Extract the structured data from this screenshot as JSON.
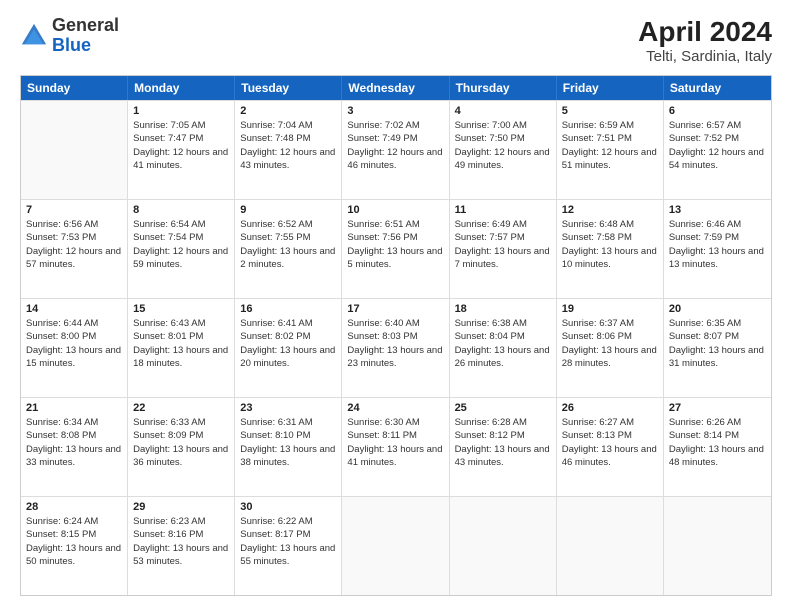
{
  "header": {
    "logo": {
      "general": "General",
      "blue": "Blue"
    },
    "title": "April 2024",
    "subtitle": "Telti, Sardinia, Italy"
  },
  "calendar": {
    "days": [
      "Sunday",
      "Monday",
      "Tuesday",
      "Wednesday",
      "Thursday",
      "Friday",
      "Saturday"
    ],
    "rows": [
      [
        {
          "day": "",
          "sunrise": "",
          "sunset": "",
          "daylight": "",
          "empty": true
        },
        {
          "day": "1",
          "sunrise": "Sunrise: 7:05 AM",
          "sunset": "Sunset: 7:47 PM",
          "daylight": "Daylight: 12 hours and 41 minutes."
        },
        {
          "day": "2",
          "sunrise": "Sunrise: 7:04 AM",
          "sunset": "Sunset: 7:48 PM",
          "daylight": "Daylight: 12 hours and 43 minutes."
        },
        {
          "day": "3",
          "sunrise": "Sunrise: 7:02 AM",
          "sunset": "Sunset: 7:49 PM",
          "daylight": "Daylight: 12 hours and 46 minutes."
        },
        {
          "day": "4",
          "sunrise": "Sunrise: 7:00 AM",
          "sunset": "Sunset: 7:50 PM",
          "daylight": "Daylight: 12 hours and 49 minutes."
        },
        {
          "day": "5",
          "sunrise": "Sunrise: 6:59 AM",
          "sunset": "Sunset: 7:51 PM",
          "daylight": "Daylight: 12 hours and 51 minutes."
        },
        {
          "day": "6",
          "sunrise": "Sunrise: 6:57 AM",
          "sunset": "Sunset: 7:52 PM",
          "daylight": "Daylight: 12 hours and 54 minutes."
        }
      ],
      [
        {
          "day": "7",
          "sunrise": "Sunrise: 6:56 AM",
          "sunset": "Sunset: 7:53 PM",
          "daylight": "Daylight: 12 hours and 57 minutes."
        },
        {
          "day": "8",
          "sunrise": "Sunrise: 6:54 AM",
          "sunset": "Sunset: 7:54 PM",
          "daylight": "Daylight: 12 hours and 59 minutes."
        },
        {
          "day": "9",
          "sunrise": "Sunrise: 6:52 AM",
          "sunset": "Sunset: 7:55 PM",
          "daylight": "Daylight: 13 hours and 2 minutes."
        },
        {
          "day": "10",
          "sunrise": "Sunrise: 6:51 AM",
          "sunset": "Sunset: 7:56 PM",
          "daylight": "Daylight: 13 hours and 5 minutes."
        },
        {
          "day": "11",
          "sunrise": "Sunrise: 6:49 AM",
          "sunset": "Sunset: 7:57 PM",
          "daylight": "Daylight: 13 hours and 7 minutes."
        },
        {
          "day": "12",
          "sunrise": "Sunrise: 6:48 AM",
          "sunset": "Sunset: 7:58 PM",
          "daylight": "Daylight: 13 hours and 10 minutes."
        },
        {
          "day": "13",
          "sunrise": "Sunrise: 6:46 AM",
          "sunset": "Sunset: 7:59 PM",
          "daylight": "Daylight: 13 hours and 13 minutes."
        }
      ],
      [
        {
          "day": "14",
          "sunrise": "Sunrise: 6:44 AM",
          "sunset": "Sunset: 8:00 PM",
          "daylight": "Daylight: 13 hours and 15 minutes."
        },
        {
          "day": "15",
          "sunrise": "Sunrise: 6:43 AM",
          "sunset": "Sunset: 8:01 PM",
          "daylight": "Daylight: 13 hours and 18 minutes."
        },
        {
          "day": "16",
          "sunrise": "Sunrise: 6:41 AM",
          "sunset": "Sunset: 8:02 PM",
          "daylight": "Daylight: 13 hours and 20 minutes."
        },
        {
          "day": "17",
          "sunrise": "Sunrise: 6:40 AM",
          "sunset": "Sunset: 8:03 PM",
          "daylight": "Daylight: 13 hours and 23 minutes."
        },
        {
          "day": "18",
          "sunrise": "Sunrise: 6:38 AM",
          "sunset": "Sunset: 8:04 PM",
          "daylight": "Daylight: 13 hours and 26 minutes."
        },
        {
          "day": "19",
          "sunrise": "Sunrise: 6:37 AM",
          "sunset": "Sunset: 8:06 PM",
          "daylight": "Daylight: 13 hours and 28 minutes."
        },
        {
          "day": "20",
          "sunrise": "Sunrise: 6:35 AM",
          "sunset": "Sunset: 8:07 PM",
          "daylight": "Daylight: 13 hours and 31 minutes."
        }
      ],
      [
        {
          "day": "21",
          "sunrise": "Sunrise: 6:34 AM",
          "sunset": "Sunset: 8:08 PM",
          "daylight": "Daylight: 13 hours and 33 minutes."
        },
        {
          "day": "22",
          "sunrise": "Sunrise: 6:33 AM",
          "sunset": "Sunset: 8:09 PM",
          "daylight": "Daylight: 13 hours and 36 minutes."
        },
        {
          "day": "23",
          "sunrise": "Sunrise: 6:31 AM",
          "sunset": "Sunset: 8:10 PM",
          "daylight": "Daylight: 13 hours and 38 minutes."
        },
        {
          "day": "24",
          "sunrise": "Sunrise: 6:30 AM",
          "sunset": "Sunset: 8:11 PM",
          "daylight": "Daylight: 13 hours and 41 minutes."
        },
        {
          "day": "25",
          "sunrise": "Sunrise: 6:28 AM",
          "sunset": "Sunset: 8:12 PM",
          "daylight": "Daylight: 13 hours and 43 minutes."
        },
        {
          "day": "26",
          "sunrise": "Sunrise: 6:27 AM",
          "sunset": "Sunset: 8:13 PM",
          "daylight": "Daylight: 13 hours and 46 minutes."
        },
        {
          "day": "27",
          "sunrise": "Sunrise: 6:26 AM",
          "sunset": "Sunset: 8:14 PM",
          "daylight": "Daylight: 13 hours and 48 minutes."
        }
      ],
      [
        {
          "day": "28",
          "sunrise": "Sunrise: 6:24 AM",
          "sunset": "Sunset: 8:15 PM",
          "daylight": "Daylight: 13 hours and 50 minutes."
        },
        {
          "day": "29",
          "sunrise": "Sunrise: 6:23 AM",
          "sunset": "Sunset: 8:16 PM",
          "daylight": "Daylight: 13 hours and 53 minutes."
        },
        {
          "day": "30",
          "sunrise": "Sunrise: 6:22 AM",
          "sunset": "Sunset: 8:17 PM",
          "daylight": "Daylight: 13 hours and 55 minutes."
        },
        {
          "day": "",
          "sunrise": "",
          "sunset": "",
          "daylight": "",
          "empty": true
        },
        {
          "day": "",
          "sunrise": "",
          "sunset": "",
          "daylight": "",
          "empty": true
        },
        {
          "day": "",
          "sunrise": "",
          "sunset": "",
          "daylight": "",
          "empty": true
        },
        {
          "day": "",
          "sunrise": "",
          "sunset": "",
          "daylight": "",
          "empty": true
        }
      ]
    ]
  }
}
